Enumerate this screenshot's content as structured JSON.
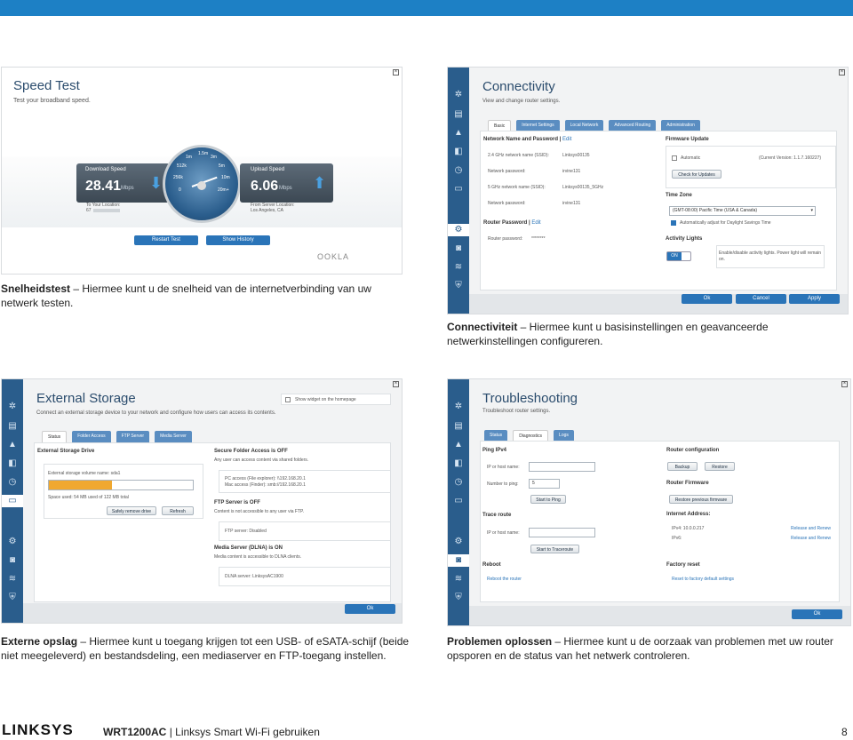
{
  "speed_test": {
    "title": "Speed Test",
    "subtitle": "Test your broadband speed.",
    "download_label": "Download Speed",
    "download_value": "28.41",
    "download_unit": "Mbps",
    "upload_label": "Upload Speed",
    "upload_value": "6.06",
    "upload_unit": "Mbps",
    "to_location_label": "To Your Location:",
    "to_location_value": "67",
    "from_location_label": "From Server Location:",
    "from_location_value": "Los Angeles, CA",
    "gauge_ticks": [
      "1m",
      "1.5m",
      "3m",
      "512k",
      "5m",
      "256k",
      "10m",
      "0",
      "20m+"
    ],
    "restart_button": "Restart Test",
    "history_button": "Show History",
    "brand": "OOKLA"
  },
  "caption_speed": {
    "bold": "Snelheidstest",
    "text": " – Hiermee kunt u de snelheid van de internetverbinding van uw netwerk testen."
  },
  "connectivity": {
    "title": "Connectivity",
    "subtitle": "View and change router settings.",
    "tabs": [
      "Basic",
      "Internet Settings",
      "Local Network",
      "Advanced Routing",
      "Administration"
    ],
    "network_heading": "Network Name and Password",
    "edit": "Edit",
    "rows": [
      {
        "label": "2.4 GHz network name (SSID):",
        "value": "Linksys00135"
      },
      {
        "label": "Network password:",
        "value": "irvine131"
      },
      {
        "label": "5 GHz network name (SSID):",
        "value": "Linksys00135_5GHz"
      },
      {
        "label": "Network password:",
        "value": "irvine131"
      }
    ],
    "router_pw_heading": "Router Password",
    "router_pw_label": "Router password:",
    "router_pw_value": "********",
    "firmware_heading": "Firmware Update",
    "automatic": "Automatic",
    "current_version": "(Current Version: 1.1.7.160227)",
    "check_updates": "Check for Updates",
    "timezone_heading": "Time Zone",
    "timezone_value": "(GMT-08:00) Pacific Time (USA & Canada)",
    "dst": "Automatically adjust for Daylight Savings Time",
    "activity_heading": "Activity Lights",
    "toggle_on": "ON",
    "activity_note": "Enable/disable activity lights. Power light will remain on.",
    "ok": "Ok",
    "cancel": "Cancel",
    "apply": "Apply"
  },
  "caption_connectivity": {
    "bold": "Connectiviteit",
    "text": " – Hiermee kunt u basisinstellingen en geavanceerde netwerkinstellingen configureren."
  },
  "storage": {
    "title": "External Storage",
    "subtitle": "Connect an external storage device to your network and configure how users can access its contents.",
    "widget": "Show widget on the homepage",
    "tabs": [
      "Status",
      "Folder Access",
      "FTP Server",
      "Media Server"
    ],
    "drive_heading": "External Storage Drive",
    "volume": "External storage volume name: sda1",
    "space": "Space used: 54 MB used of 122 MB total",
    "usage_fraction": 0.44,
    "safe_remove": "Safely remove drive",
    "refresh": "Refresh",
    "secure_heading": "Secure Folder Access is OFF",
    "secure_note": "Any user can access content via shared folders.",
    "pc_access": "PC access (File explorer): \\\\192.168.20.1",
    "mac_access": "Mac access (Finder): smb://192.168.20.1",
    "ftp_heading": "FTP Server is OFF",
    "ftp_note": "Content is not accessible to any user via FTP.",
    "ftp_status": "FTP server: Disabled",
    "dlna_heading": "Media Server (DLNA) is ON",
    "dlna_note": "Media content is accessible to DLNA clients.",
    "dlna_server": "DLNA server: LinksysAC1900",
    "ok": "Ok"
  },
  "caption_storage": {
    "bold": "Externe opslag",
    "text": " – Hiermee kunt u toegang krijgen tot een USB- of eSATA-schijf (beide niet meegeleverd) en bestandsdeling, een mediaserver en FTP-toegang instellen."
  },
  "trouble": {
    "title": "Troubleshooting",
    "subtitle": "Troubleshoot router settings.",
    "tabs": [
      "Status",
      "Diagnostics",
      "Logs"
    ],
    "ping_heading": "Ping IPv4",
    "ip_label": "IP or host name:",
    "number_label": "Number to ping:",
    "number_value": "5",
    "start_ping": "Start to Ping",
    "trace_heading": "Trace route",
    "start_trace": "Start to Traceroute",
    "reboot_heading": "Reboot",
    "reboot_link": "Reboot the router",
    "config_heading": "Router configuration",
    "backup": "Backup",
    "restore": "Restore",
    "firmware_heading": "Router Firmware",
    "restore_firmware": "Restore previous firmware",
    "ip_heading": "Internet Address:",
    "ipv4_label": "IPv4: 10.0.0.217",
    "ipv6_label": "IPv6:",
    "release": "Release and Renew",
    "factory_heading": "Factory reset",
    "factory_link": "Reset to factory default settings",
    "ok": "Ok"
  },
  "caption_trouble": {
    "bold": "Problemen oplossen",
    "text": " – Hiermee kunt u de oorzaak van problemen met uw router opsporen en de status van het netwerk controleren."
  },
  "footer": {
    "logo": "LINKSYS",
    "model": "WRT1200AC",
    "separator": " | ",
    "guide": "Linksys Smart Wi-Fi gebruiken",
    "page": "8"
  }
}
